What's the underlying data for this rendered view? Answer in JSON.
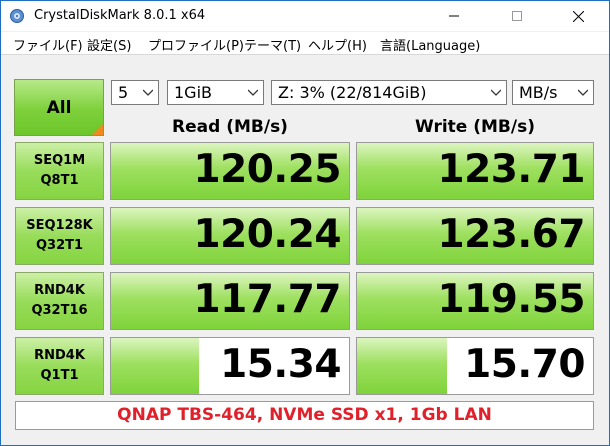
{
  "window": {
    "title": "CrystalDiskMark 8.0.1 x64"
  },
  "menu": [
    "ファイル(F)",
    "設定(S)",
    "プロファイル(P)",
    "テーマ(T)",
    "ヘルプ(H)",
    "言語(Language)"
  ],
  "controls": {
    "all_label": "All",
    "count": "5",
    "size": "1GiB",
    "drive": "Z: 3% (22/814GiB)",
    "unit": "MB/s"
  },
  "headers": {
    "read": "Read (MB/s)",
    "write": "Write (MB/s)"
  },
  "tests": [
    {
      "line1": "SEQ1M",
      "line2": "Q8T1",
      "read": "120.25",
      "write": "123.71",
      "read_fill": 1.0,
      "write_fill": 1.0
    },
    {
      "line1": "SEQ128K",
      "line2": "Q32T1",
      "read": "120.24",
      "write": "123.67",
      "read_fill": 1.0,
      "write_fill": 1.0
    },
    {
      "line1": "RND4K",
      "line2": "Q32T16",
      "read": "117.77",
      "write": "119.55",
      "read_fill": 1.0,
      "write_fill": 1.0
    },
    {
      "line1": "RND4K",
      "line2": "Q1T1",
      "read": "15.34",
      "write": "15.70",
      "read_fill": 0.37,
      "write_fill": 0.38
    }
  ],
  "comment": "QNAP TBS-464, NVMe SSD x1, 1Gb LAN",
  "colors": {
    "accent_green": "#7ed03a",
    "comment_red": "#e0202a",
    "corner_orange": "#f08a1c"
  }
}
